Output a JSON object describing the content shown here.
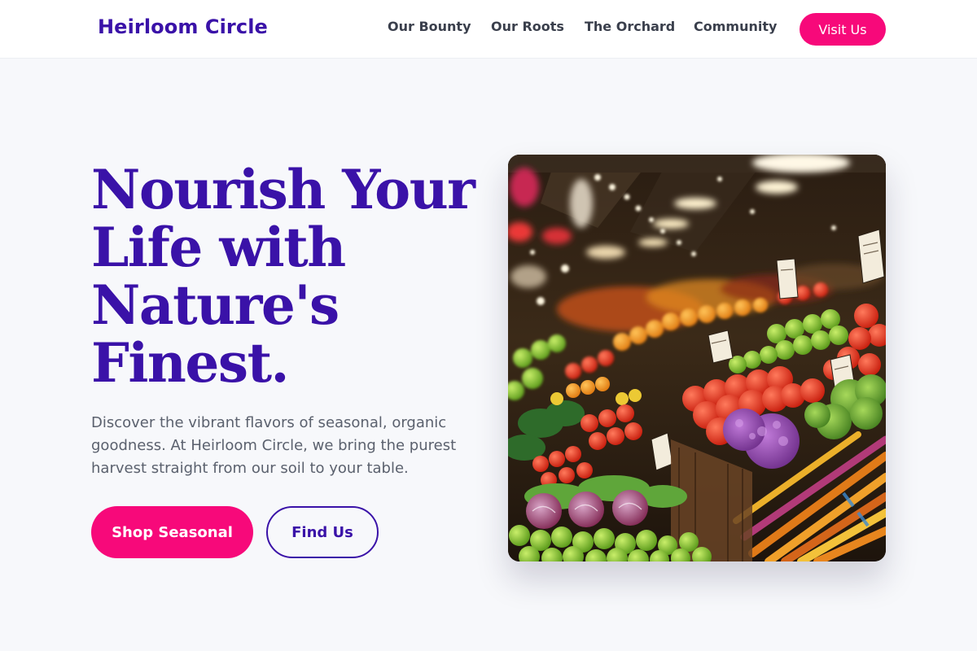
{
  "header": {
    "brand": "Heirloom Circle",
    "nav": [
      {
        "label": "Our Bounty"
      },
      {
        "label": "Our Roots"
      },
      {
        "label": "The Orchard"
      },
      {
        "label": "Community"
      }
    ],
    "cta_label": "Visit Us"
  },
  "hero": {
    "title": "Nourish Your Life with Nature's Finest.",
    "description": "Discover the vibrant flavors of seasonal, organic goodness. At Heirloom Circle, we bring the purest harvest straight from our soil to your table.",
    "primary_button": "Shop Seasonal",
    "secondary_button": "Find Us"
  },
  "image": {
    "subject": "farmers-market-produce-stall"
  },
  "colors": {
    "brand_purple": "#3a12a8",
    "accent_pink": "#f7097a",
    "background": "#f7f8fb",
    "body_text": "#5b616e"
  }
}
